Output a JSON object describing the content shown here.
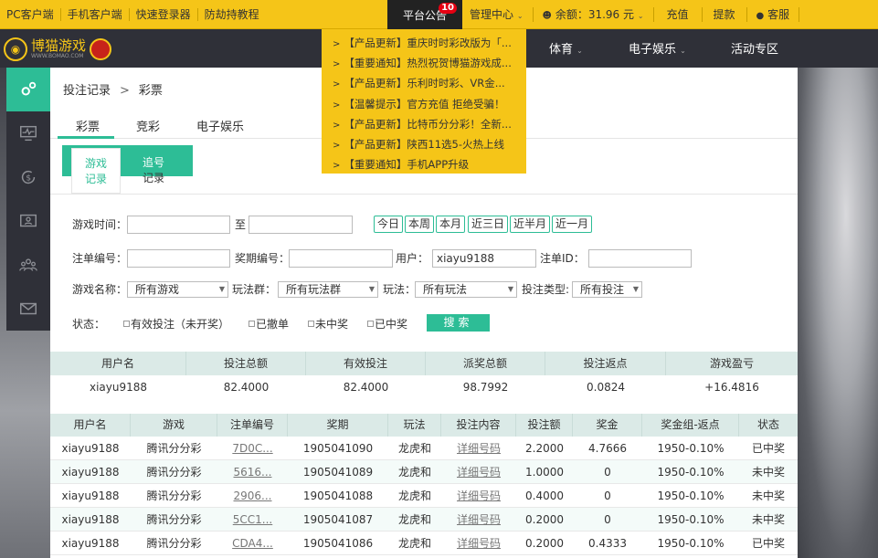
{
  "topbar": {
    "links": [
      "PC客户端",
      "手机客户端",
      "快速登录器",
      "防劫持教程"
    ],
    "notice_label": "平台公告",
    "notice_count": "10",
    "manage_label": "管理中心",
    "balance_label": "余额：31.96 元",
    "recharge_label": "充值",
    "withdraw_label": "提款",
    "service_label": "客服"
  },
  "nav": {
    "logo_text": "博猫游戏",
    "logo_sub": "WWW.BOMAO.COM",
    "menu": [
      "体育",
      "电子娱乐",
      "活动专区"
    ]
  },
  "notices": [
    "【产品更新】重庆时时彩改版为「...",
    "【重要通知】热烈祝贺博猫游戏成...",
    "【产品更新】乐利时时彩、VR金...",
    "【温馨提示】官方充值 拒绝受骗！",
    "【产品更新】比特币分分彩！全新...",
    "【产品更新】陕西11选5-火热上线",
    "【重要通知】手机APP升级"
  ],
  "breadcrumb": {
    "root": "投注记录",
    "sep": ">",
    "current": "彩票"
  },
  "tabs": [
    "彩票",
    "竞彩",
    "电子娱乐"
  ],
  "subtabs": {
    "game_record": [
      "游戏",
      "记录"
    ],
    "chase_record": [
      "追号",
      "记录"
    ]
  },
  "filters": {
    "time_label": "游戏时间：",
    "to_label": "至",
    "quick": [
      "今日",
      "本周",
      "本月",
      "近三日",
      "近半月",
      "近一月"
    ],
    "order_label": "注单编号：",
    "issue_label": "奖期编号：",
    "user_label": "用户：",
    "user_value": "xiayu9188",
    "orderid_label": "注单ID：",
    "game_name_label": "游戏名称：",
    "game_name_value": "所有游戏",
    "play_group_label": "玩法群：",
    "play_group_value": "所有玩法群",
    "play_label": "玩法：",
    "play_value": "所有玩法",
    "bet_type_label": "投注类型:",
    "bet_type_value": "所有投注",
    "status_label": "状态：",
    "statuses": [
      "有效投注（未开奖）",
      "已撤单",
      "未中奖",
      "已中奖"
    ],
    "search_label": "搜索"
  },
  "summary": {
    "headers": [
      "用户名",
      "投注总额",
      "有效投注",
      "派奖总额",
      "投注返点",
      "游戏盈亏"
    ],
    "values": [
      "xiayu9188",
      "82.4000",
      "82.4000",
      "98.7992",
      "0.0824",
      "+16.4816"
    ]
  },
  "table": {
    "headers": [
      "用户名",
      "游戏",
      "注单编号",
      "奖期",
      "玩法",
      "投注内容",
      "投注额",
      "奖金",
      "奖金组-返点",
      "状态"
    ],
    "rows": [
      [
        "xiayu9188",
        "腾讯分分彩",
        "7D0C...",
        "1905041090",
        "龙虎和",
        "详细号码",
        "2.2000",
        "4.7666",
        "1950-0.10%",
        "已中奖"
      ],
      [
        "xiayu9188",
        "腾讯分分彩",
        "5616...",
        "1905041089",
        "龙虎和",
        "详细号码",
        "1.0000",
        "0",
        "1950-0.10%",
        "未中奖"
      ],
      [
        "xiayu9188",
        "腾讯分分彩",
        "2906...",
        "1905041088",
        "龙虎和",
        "详细号码",
        "0.4000",
        "0",
        "1950-0.10%",
        "未中奖"
      ],
      [
        "xiayu9188",
        "腾讯分分彩",
        "5CC1...",
        "1905041087",
        "龙虎和",
        "详细号码",
        "0.2000",
        "0",
        "1950-0.10%",
        "未中奖"
      ],
      [
        "xiayu9188",
        "腾讯分分彩",
        "CDA4...",
        "1905041086",
        "龙虎和",
        "详细号码",
        "0.2000",
        "0.4333",
        "1950-0.10%",
        "已中奖"
      ]
    ]
  },
  "colors": {
    "accent": "#2dbd96",
    "brand": "#f5c518",
    "dark": "#2f3038"
  }
}
